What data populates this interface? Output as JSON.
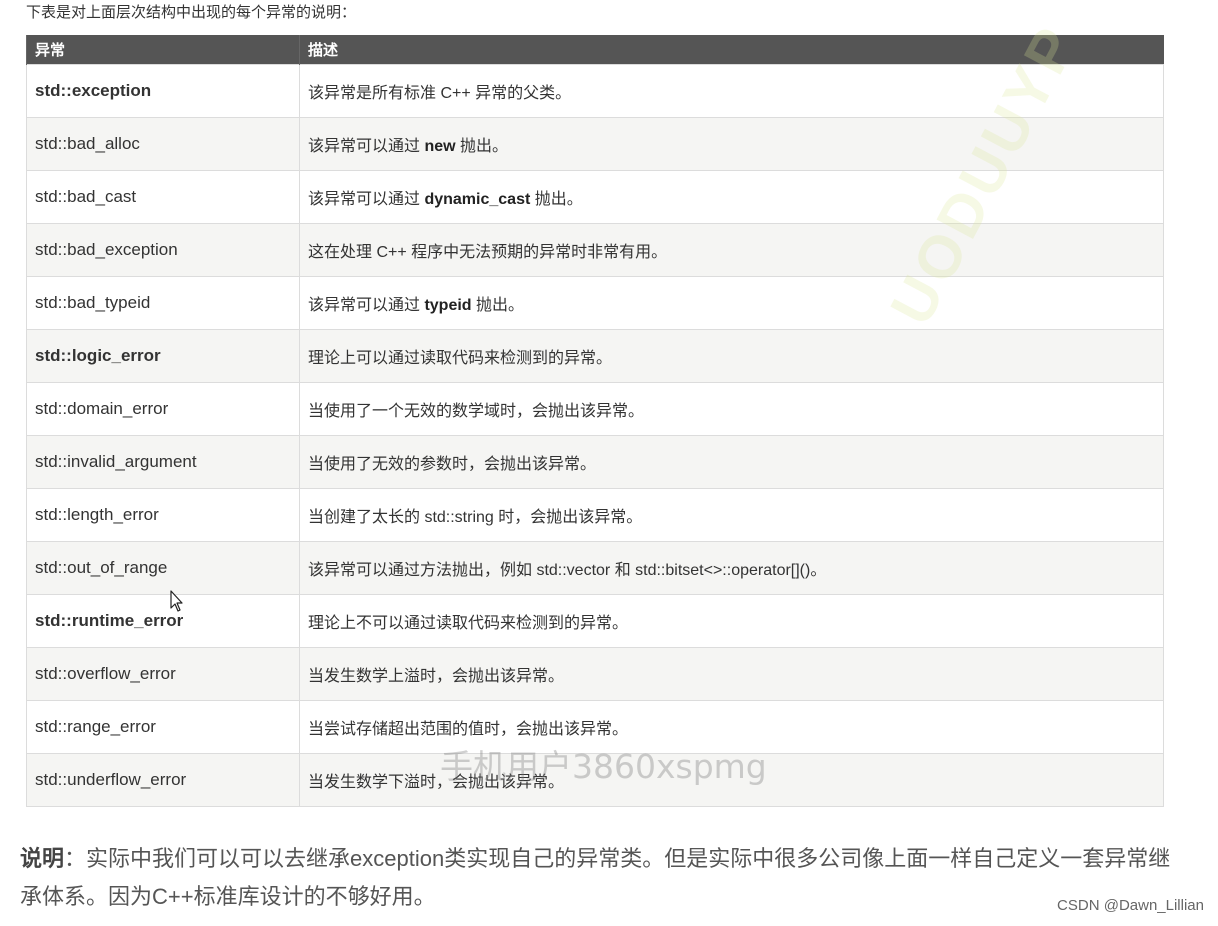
{
  "intro": "下表是对上面层次结构中出现的每个异常的说明：",
  "table": {
    "headers": [
      "异常",
      "描述"
    ],
    "rows": [
      {
        "name": "std::exception",
        "name_bold": true,
        "desc_pre": "该异常是所有标准 C++ 异常的父类。",
        "desc_bold": "",
        "desc_post": ""
      },
      {
        "name": "std::bad_alloc",
        "name_bold": false,
        "desc_pre": "该异常可以通过 ",
        "desc_bold": "new",
        "desc_post": " 抛出。"
      },
      {
        "name": "std::bad_cast",
        "name_bold": false,
        "desc_pre": "该异常可以通过 ",
        "desc_bold": "dynamic_cast",
        "desc_post": " 抛出。"
      },
      {
        "name": "std::bad_exception",
        "name_bold": false,
        "desc_pre": "这在处理 C++ 程序中无法预期的异常时非常有用。",
        "desc_bold": "",
        "desc_post": ""
      },
      {
        "name": "std::bad_typeid",
        "name_bold": false,
        "desc_pre": "该异常可以通过 ",
        "desc_bold": "typeid",
        "desc_post": " 抛出。"
      },
      {
        "name": "std::logic_error",
        "name_bold": true,
        "desc_pre": "理论上可以通过读取代码来检测到的异常。",
        "desc_bold": "",
        "desc_post": ""
      },
      {
        "name": "std::domain_error",
        "name_bold": false,
        "desc_pre": "当使用了一个无效的数学域时，会抛出该异常。",
        "desc_bold": "",
        "desc_post": ""
      },
      {
        "name": "std::invalid_argument",
        "name_bold": false,
        "desc_pre": "当使用了无效的参数时，会抛出该异常。",
        "desc_bold": "",
        "desc_post": ""
      },
      {
        "name": "std::length_error",
        "name_bold": false,
        "desc_pre": "当创建了太长的 std::string 时，会抛出该异常。",
        "desc_bold": "",
        "desc_post": ""
      },
      {
        "name": "std::out_of_range",
        "name_bold": false,
        "desc_pre": "该异常可以通过方法抛出，例如 std::vector 和 std::bitset<>::operator[]()。",
        "desc_bold": "",
        "desc_post": ""
      },
      {
        "name": "std::runtime_error",
        "name_bold": true,
        "desc_pre": "理论上不可以通过读取代码来检测到的异常。",
        "desc_bold": "",
        "desc_post": ""
      },
      {
        "name": "std::overflow_error",
        "name_bold": false,
        "desc_pre": "当发生数学上溢时，会抛出该异常。",
        "desc_bold": "",
        "desc_post": ""
      },
      {
        "name": "std::range_error",
        "name_bold": false,
        "desc_pre": "当尝试存储超出范围的值时，会抛出该异常。",
        "desc_bold": "",
        "desc_post": ""
      },
      {
        "name": "std::underflow_error",
        "name_bold": false,
        "desc_pre": "当发生数学下溢时，会抛出该异常。",
        "desc_bold": "",
        "desc_post": ""
      }
    ]
  },
  "watermark_center": "手机用户3860xspmg",
  "watermark_diag": "UODUUYP",
  "note": {
    "label": "说明",
    "text": "：实际中我们可以可以去继承exception类实现自己的异常类。但是实际中很多公司像上面一样自己定义一套异常继承体系。因为C++标准库设计的不够好用。"
  },
  "credit": "CSDN @Dawn_Lillian",
  "icons": {
    "cursor": "mouse-pointer-icon"
  }
}
